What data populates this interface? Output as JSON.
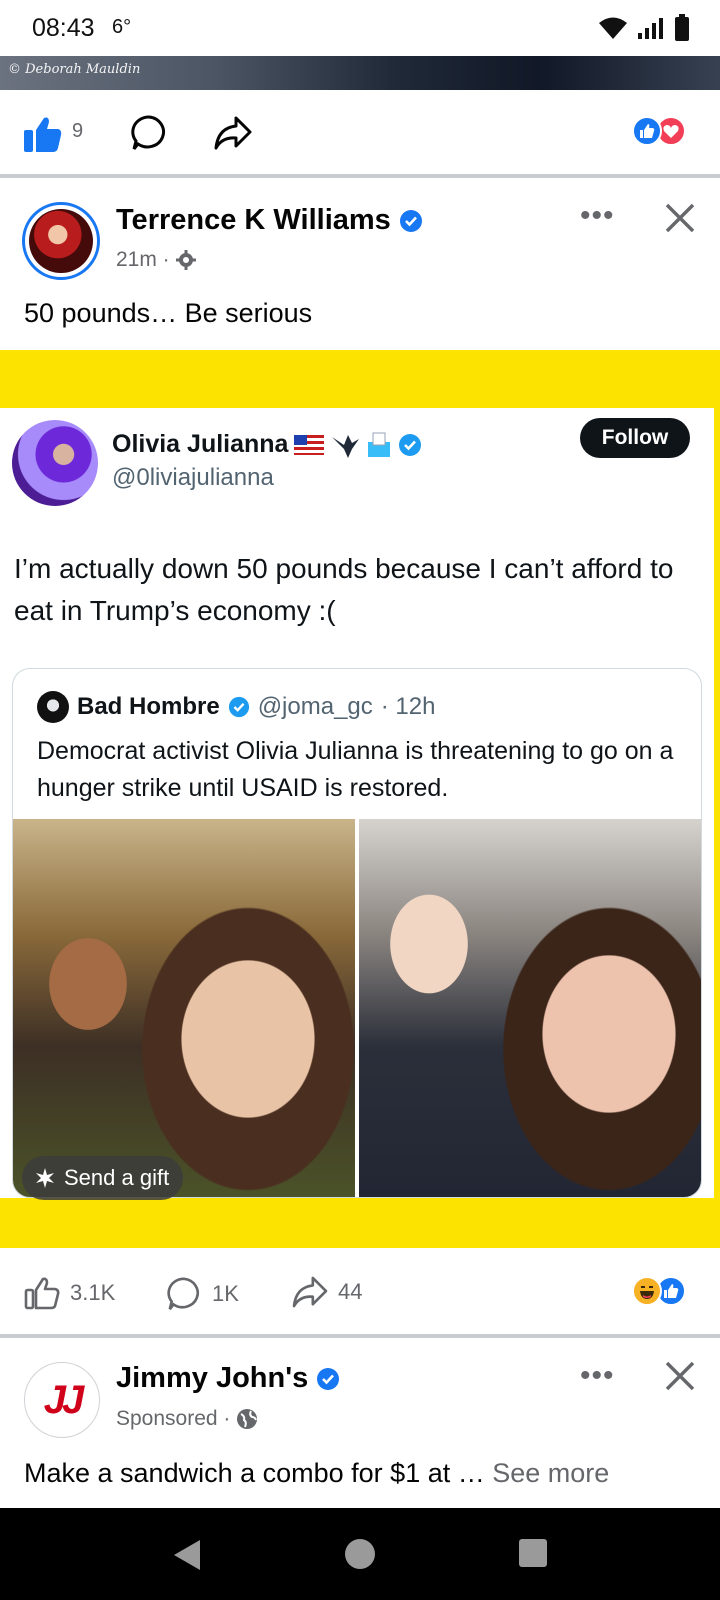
{
  "status_bar": {
    "time": "08:43",
    "temperature": "6°"
  },
  "previous_post": {
    "image_credit": "© Deborah Mauldin",
    "like_count": "9"
  },
  "post": {
    "author": "Terrence K Williams",
    "time": "21m ·",
    "text": "50 pounds… Be serious",
    "tweet": {
      "name": "Olivia Julianna",
      "handle": "@0liviajulianna",
      "follow_label": "Follow",
      "text": "I’m actually down 50 pounds because I can’t afford to eat in Trump’s economy :(",
      "quote": {
        "name": "Bad Hombre",
        "handle": "@joma_gc",
        "time": "· 12h",
        "text": "Democrat activist Olivia Julianna is threatening to go on a hunger strike until USAID is restored."
      }
    },
    "gift_label": "Send a gift",
    "likes": "3.1K",
    "comments": "1K",
    "shares": "44"
  },
  "ad_post": {
    "author": "Jimmy John's",
    "meta": "Sponsored ·",
    "logo_text": "JJ",
    "text": "Make a sandwich a combo for $1 at … ",
    "see_more": "See more"
  },
  "colors": {
    "accent": "#1877f2",
    "yellow_frame": "#fde400",
    "love": "#f33e58",
    "haha": "#f7b125"
  }
}
